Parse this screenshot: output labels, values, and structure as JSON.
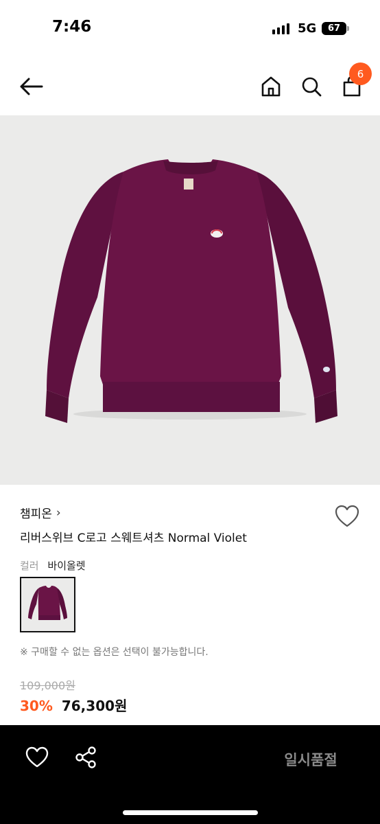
{
  "status_bar": {
    "time": "7:46",
    "network": "5G",
    "battery": "67"
  },
  "nav": {
    "back_icon": "arrow-left-icon",
    "home_icon": "home-icon",
    "search_icon": "search-icon",
    "cart_icon": "shopping-bag-icon",
    "cart_count": "6"
  },
  "product": {
    "image_icon": "purple-sweatshirt-image",
    "brand": "챔피온",
    "brand_chevron": "›",
    "name": "리버스위브 C로고 스웨트셔츠 Normal Violet",
    "color_label": "컬러",
    "color_value": "바이올렛",
    "notice": "※ 구매할 수 없는 옵션은 선택이 불가능합니다.",
    "original_price": "109,000원",
    "discount": "30%",
    "sale_price": "76,300원"
  },
  "bottom_bar": {
    "wishlist_icon": "heart-outline-icon",
    "share_icon": "share-icon",
    "soldout_label": "일시품절"
  },
  "colors": {
    "accent": "#ff5a1f",
    "sweatshirt": "#6a1446",
    "image_bg": "#ebebea"
  }
}
